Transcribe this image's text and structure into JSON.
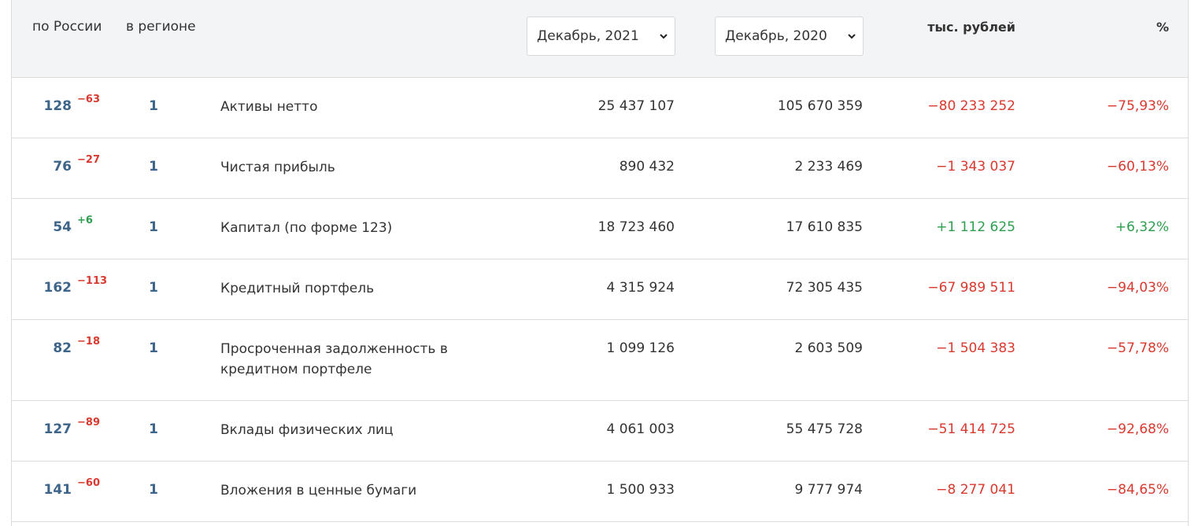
{
  "header": {
    "rank_russia_label": "по России",
    "rank_region_label": "в регионе",
    "period1": "Декабрь, 2021",
    "period2": "Декабрь, 2020",
    "unit_label": "тыс. рублей",
    "percent_label": "%"
  },
  "rows": [
    {
      "rank": "128",
      "delta": "−63",
      "delta_sign": "neg",
      "region_rank": "1",
      "label": "Активы нетто",
      "v1": "25 437 107",
      "v2": "105 670 359",
      "diff": "−80 233 252",
      "pct": "−75,93%"
    },
    {
      "rank": "76",
      "delta": "−27",
      "delta_sign": "neg",
      "region_rank": "1",
      "label": "Чистая прибыль",
      "v1": "890 432",
      "v2": "2 233 469",
      "diff": "−1 343 037",
      "pct": "−60,13%"
    },
    {
      "rank": "54",
      "delta": "+6",
      "delta_sign": "pos",
      "region_rank": "1",
      "label": "Капитал (по форме 123)",
      "v1": "18 723 460",
      "v2": "17 610 835",
      "diff": "+1 112 625",
      "pct": "+6,32%"
    },
    {
      "rank": "162",
      "delta": "−113",
      "delta_sign": "neg",
      "region_rank": "1",
      "label": "Кредитный портфель",
      "v1": "4 315 924",
      "v2": "72 305 435",
      "diff": "−67 989 511",
      "pct": "−94,03%"
    },
    {
      "rank": "82",
      "delta": "−18",
      "delta_sign": "neg",
      "region_rank": "1",
      "label": "Просроченная задолженность в кредитном портфеле",
      "v1": "1 099 126",
      "v2": "2 603 509",
      "diff": "−1 504 383",
      "pct": "−57,78%"
    },
    {
      "rank": "127",
      "delta": "−89",
      "delta_sign": "neg",
      "region_rank": "1",
      "label": "Вклады физических лиц",
      "v1": "4 061 003",
      "v2": "55 475 728",
      "diff": "−51 414 725",
      "pct": "−92,68%"
    },
    {
      "rank": "141",
      "delta": "−60",
      "delta_sign": "neg",
      "region_rank": "1",
      "label": "Вложения в ценные бумаги",
      "v1": "1 500 933",
      "v2": "9 777 974",
      "diff": "−8 277 041",
      "pct": "−84,65%"
    }
  ],
  "colors": {
    "negative": "#d9392e",
    "positive": "#2e9e4f",
    "rank": "#3d6489"
  }
}
